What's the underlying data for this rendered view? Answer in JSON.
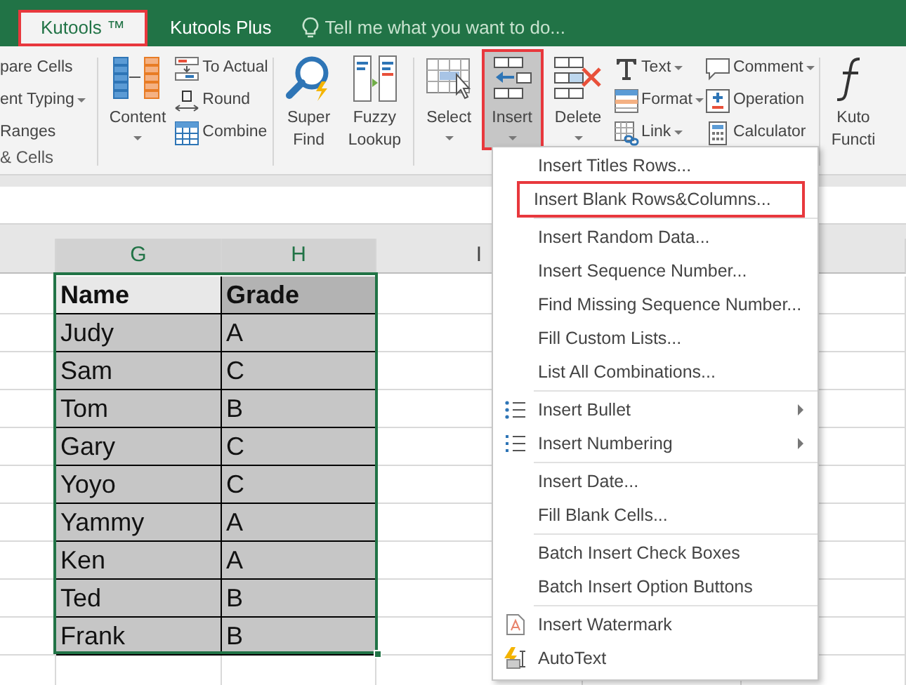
{
  "ribbon_tabs": [
    {
      "label": "Kutools ™",
      "selected": true,
      "annotated": true
    },
    {
      "label": "Kutools Plus",
      "selected": false,
      "annotated": false
    }
  ],
  "tell_me": {
    "placeholder": "Tell me what you want to do..."
  },
  "ribbon": {
    "groups": [
      {
        "label": "& Cells",
        "columns": [
          {
            "kind": "small",
            "items": [
              {
                "label": "pare Cells",
                "dropdown": false
              },
              {
                "label": "ent Typing",
                "dropdown": true
              },
              {
                "label": "Ranges",
                "dropdown": false
              }
            ]
          }
        ]
      },
      {
        "columns": [
          {
            "kind": "large",
            "lines": [
              "Content"
            ],
            "dropdown": true,
            "selected": false,
            "annotated": false
          },
          {
            "kind": "small",
            "items": [
              {
                "label": "To Actual",
                "dropdown": false
              },
              {
                "label": "Round",
                "dropdown": false
              },
              {
                "label": "Combine",
                "dropdown": false
              }
            ]
          }
        ]
      },
      {
        "columns": [
          {
            "kind": "large",
            "lines": [
              "Super",
              "Find"
            ],
            "dropdown": false,
            "selected": false,
            "annotated": false
          },
          {
            "kind": "large",
            "lines": [
              "Fuzzy",
              "Lookup"
            ],
            "dropdown": false,
            "selected": false,
            "annotated": false
          }
        ]
      },
      {
        "columns": [
          {
            "kind": "large",
            "lines": [
              "Select"
            ],
            "dropdown": true,
            "selected": false,
            "annotated": false
          },
          {
            "kind": "large",
            "lines": [
              "Insert"
            ],
            "dropdown": true,
            "selected": true,
            "annotated": true
          },
          {
            "kind": "large",
            "lines": [
              "Delete"
            ],
            "dropdown": true,
            "selected": false,
            "annotated": false
          },
          {
            "kind": "small",
            "items": [
              {
                "label": "Text",
                "dropdown": true
              },
              {
                "label": "Format",
                "dropdown": true
              },
              {
                "label": "Link",
                "dropdown": true
              }
            ]
          },
          {
            "kind": "small",
            "items": [
              {
                "label": "Comment",
                "dropdown": true
              },
              {
                "label": "Operation",
                "dropdown": false
              },
              {
                "label": "Calculator",
                "dropdown": false
              }
            ]
          }
        ]
      },
      {
        "columns": [
          {
            "kind": "large",
            "lines": [
              "Kuto",
              "Functi"
            ],
            "dropdown": false,
            "selected": false,
            "annotated": false
          }
        ]
      }
    ]
  },
  "sheet": {
    "columns": [
      {
        "label": "G",
        "selected": true
      },
      {
        "label": "H",
        "selected": true
      },
      {
        "label": "I",
        "selected": false
      }
    ],
    "table": {
      "selected": true,
      "header": [
        "Name",
        "Grade"
      ],
      "rows": [
        [
          "Judy",
          "A"
        ],
        [
          "Sam",
          "C"
        ],
        [
          "Tom",
          "B"
        ],
        [
          "Gary",
          "C"
        ],
        [
          "Yoyo",
          "C"
        ],
        [
          "Yammy",
          "A"
        ],
        [
          "Ken",
          "A"
        ],
        [
          "Ted",
          "B"
        ],
        [
          "Frank",
          "B"
        ]
      ]
    }
  },
  "menu": {
    "sections": [
      [
        {
          "label": "Insert Titles Rows...",
          "kind": "item",
          "annotated": false
        },
        {
          "label": "Insert Blank Rows&Columns...",
          "kind": "item",
          "annotated": true
        }
      ],
      [
        {
          "label": "Insert Random Data...",
          "kind": "item",
          "annotated": false
        },
        {
          "label": "Insert Sequence Number...",
          "kind": "item",
          "annotated": false
        },
        {
          "label": "Find Missing Sequence Number...",
          "kind": "item",
          "annotated": false
        },
        {
          "label": "Fill Custom Lists...",
          "kind": "item",
          "annotated": false
        },
        {
          "label": "List All Combinations...",
          "kind": "item",
          "annotated": false
        }
      ],
      [
        {
          "label": "Insert Bullet",
          "kind": "submenu",
          "annotated": false
        },
        {
          "label": "Insert Numbering",
          "kind": "submenu",
          "annotated": false
        }
      ],
      [
        {
          "label": "Insert Date...",
          "kind": "item",
          "annotated": false
        },
        {
          "label": "Fill Blank Cells...",
          "kind": "item",
          "annotated": false
        }
      ],
      [
        {
          "label": "Batch Insert Check Boxes",
          "kind": "item",
          "annotated": false
        },
        {
          "label": "Batch Insert Option Buttons",
          "kind": "item",
          "annotated": false
        }
      ],
      [
        {
          "label": "Insert Watermark",
          "kind": "item",
          "annotated": false
        },
        {
          "label": "AutoText",
          "kind": "item",
          "annotated": false
        }
      ]
    ]
  }
}
